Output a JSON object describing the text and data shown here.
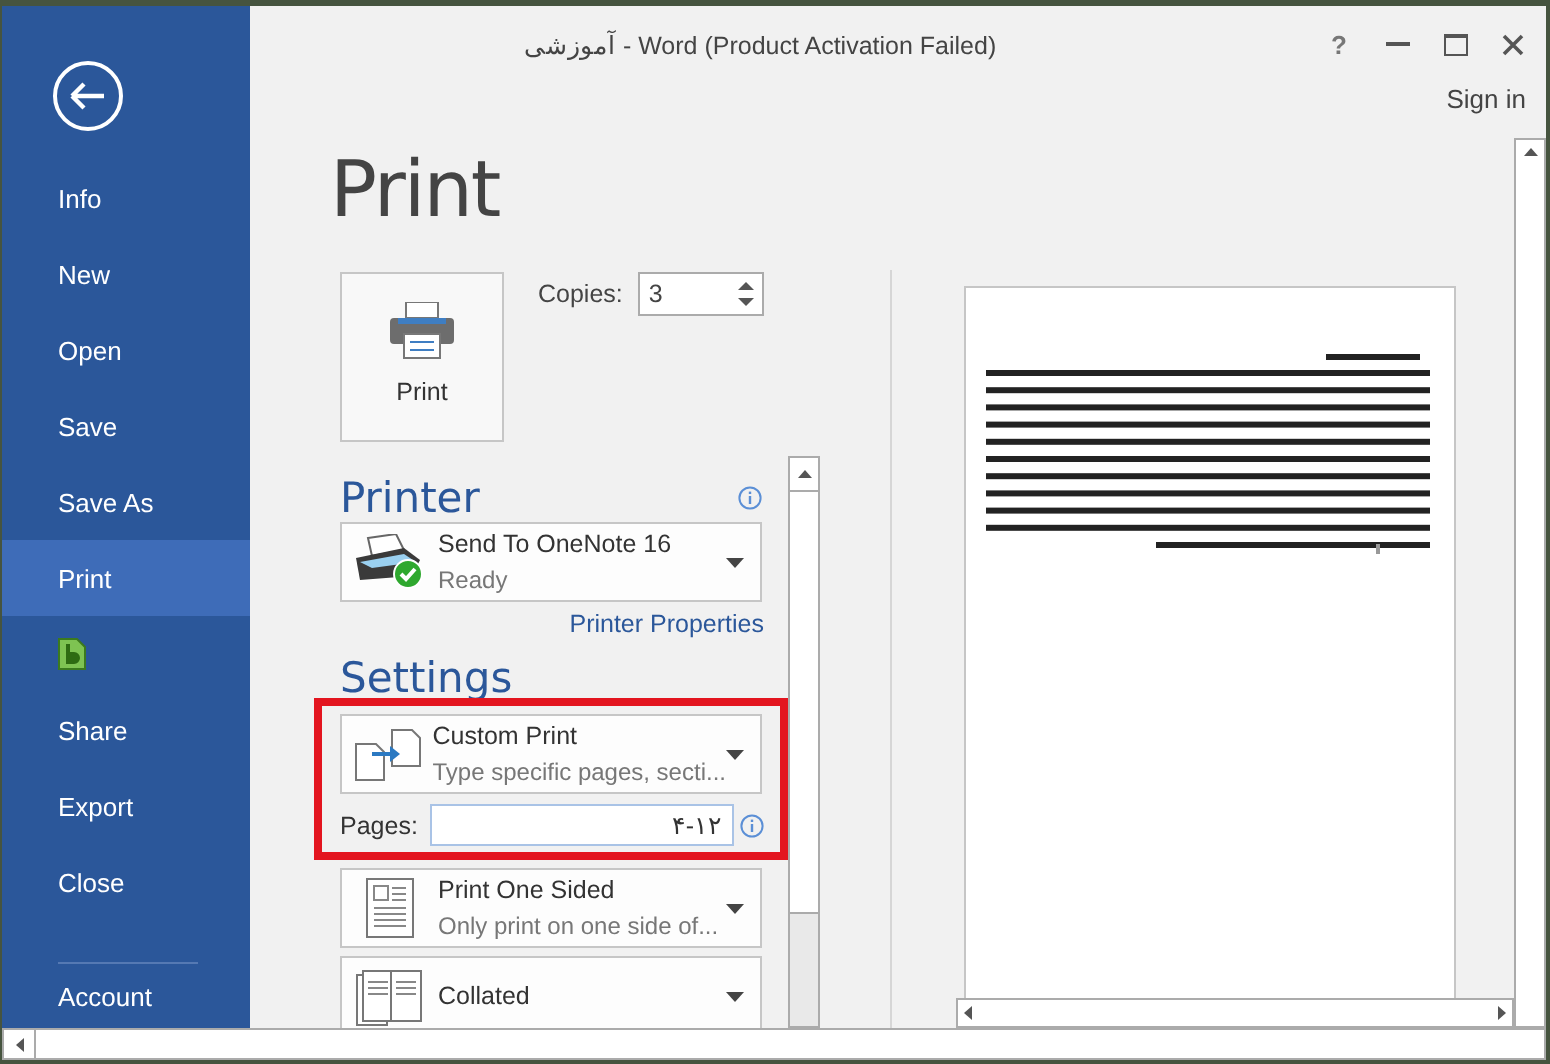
{
  "window": {
    "title": "آموزشی - Word (Product Activation Failed)",
    "help": "?",
    "sign_in": "Sign in"
  },
  "sidebar": {
    "items": [
      {
        "kind": "text",
        "label": "Info",
        "selected": false
      },
      {
        "kind": "text",
        "label": "New",
        "selected": false
      },
      {
        "kind": "text",
        "label": "Open",
        "selected": false
      },
      {
        "kind": "text",
        "label": "Save",
        "selected": false
      },
      {
        "kind": "text",
        "label": "Save As",
        "selected": false
      },
      {
        "kind": "text",
        "label": "Print",
        "selected": true
      },
      {
        "kind": "icon",
        "selected": false
      },
      {
        "kind": "text",
        "label": "Share",
        "selected": false
      },
      {
        "kind": "text",
        "label": "Export",
        "selected": false
      },
      {
        "kind": "text",
        "label": "Close",
        "selected": false
      }
    ],
    "footer_items": [
      {
        "kind": "text",
        "label": "Account",
        "selected": false
      }
    ]
  },
  "print": {
    "heading": "Print",
    "button": "Print",
    "copies_label": "Copies:",
    "copies": "3"
  },
  "printer": {
    "heading": "Printer",
    "name": "Send To OneNote 16",
    "status": "Ready",
    "properties_link": "Printer Properties"
  },
  "settings": {
    "heading": "Settings",
    "items": [
      {
        "kind": "dropdown",
        "title": "Custom Print",
        "description": "Type specific pages, secti...",
        "highlighted": true
      },
      {
        "kind": "field",
        "label": "Pages:",
        "value": "۴-۱۲",
        "highlighted": true
      },
      {
        "kind": "dropdown",
        "title": "Print One Sided",
        "description": "Only print on one side of...",
        "highlighted": false
      },
      {
        "kind": "dropdown",
        "title": "Collated",
        "highlighted": false
      }
    ]
  }
}
